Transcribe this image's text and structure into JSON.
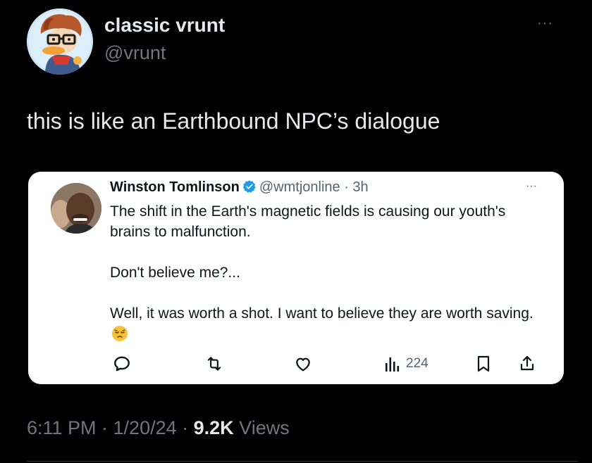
{
  "author": {
    "display_name": "classic vrunt",
    "handle": "@vrunt",
    "more_label": "···"
  },
  "tweet": {
    "text": "this is like an Earthbound NPC’s dialogue"
  },
  "quoted": {
    "name": "Winston Tomlinson",
    "handle_time": "@wmtjonline · 3h",
    "more_label": "···",
    "paragraphs": [
      "The shift in the Earth's magnetic fields is causing our youth's brains to malfunction.",
      "Don't believe me?...",
      "Well, it was worth a shot. I want to believe they are worth saving."
    ],
    "views": "224",
    "icons": [
      "reply-icon",
      "retweet-icon",
      "like-icon",
      "views-icon",
      "bookmark-icon",
      "share-icon"
    ]
  },
  "footer": {
    "time_date": "6:11 PM · 1/20/24 · ",
    "views_num": "9.2K",
    "views_label": " Views"
  },
  "colors": {
    "background": "#000000",
    "card": "#ffffff",
    "verified": "#1d9bf0",
    "muted": "#71767b"
  }
}
